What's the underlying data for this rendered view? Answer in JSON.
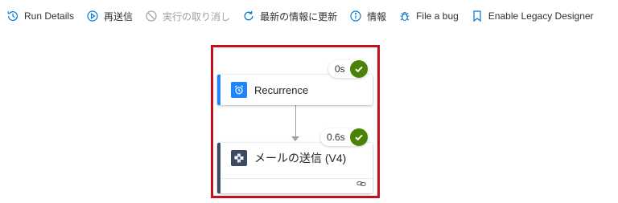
{
  "toolbar": {
    "run_details": "Run Details",
    "resubmit": "再送信",
    "cancel_run": "実行の取り消し",
    "refresh": "最新の情報に更新",
    "info": "情報",
    "file_bug": "File a bug",
    "legacy_designer": "Enable Legacy Designer"
  },
  "steps": [
    {
      "title": "Recurrence",
      "duration": "0s",
      "status": "succeeded",
      "icon": "alarm-clock-icon",
      "accent": "#1f85ff"
    },
    {
      "title": "メールの送信 (V4)",
      "duration": "0.6s",
      "status": "succeeded",
      "icon": "sendgrid-icon",
      "accent": "#3c4a63",
      "link_icon": "link-icon"
    }
  ],
  "colors": {
    "highlight": "#c50f1f",
    "success": "#498205",
    "accent": "#0078d4",
    "disabled": "#a19f9d"
  }
}
